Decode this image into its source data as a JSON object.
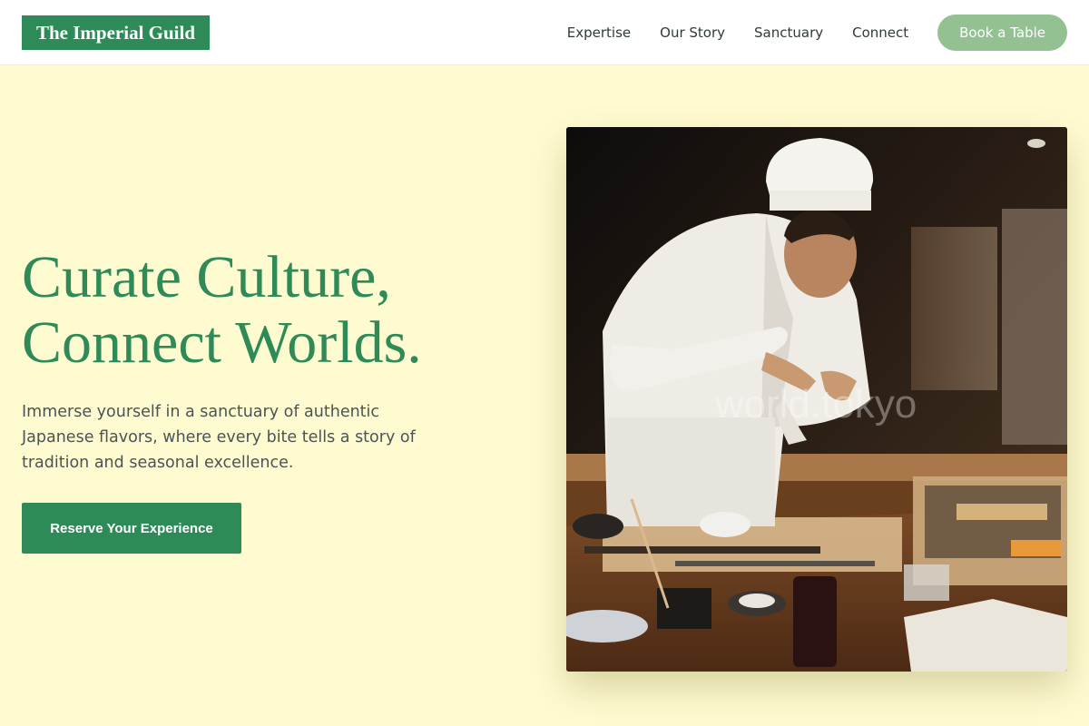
{
  "brand": {
    "name": "The Imperial Guild"
  },
  "nav": {
    "items": [
      {
        "label": "Expertise"
      },
      {
        "label": "Our Story"
      },
      {
        "label": "Sanctuary"
      },
      {
        "label": "Connect"
      }
    ],
    "book_label": "Book a Table"
  },
  "hero": {
    "title_line1": "Curate Culture,",
    "title_line2": "Connect Worlds.",
    "subtitle": "Immerse yourself in a sanctuary of authentic Japanese flavors, where every bite tells a story of tradition and seasonal excellence.",
    "cta_label": "Reserve Your Experience",
    "image_watermark": "world.tokyo"
  },
  "colors": {
    "brand_green": "#2e8b57",
    "button_light_green": "#93c191",
    "page_background": "#fffbd1",
    "header_background": "#ffffff"
  }
}
